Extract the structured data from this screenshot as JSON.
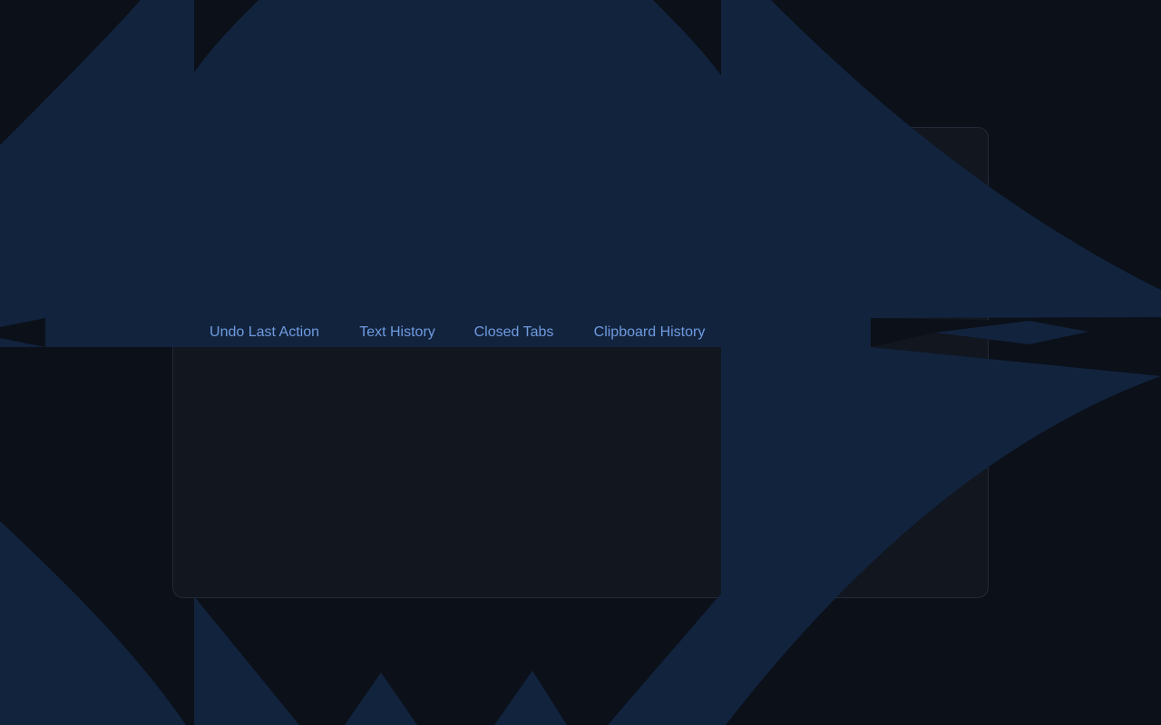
{
  "colors": {
    "background": "#0b1019",
    "overlay": "#12233d",
    "panel": "#11161f",
    "panel_border": "#232a36",
    "tab_text": "#6f9be0"
  },
  "tabs": [
    {
      "label": "Undo Last Action"
    },
    {
      "label": "Text History"
    },
    {
      "label": "Closed Tabs"
    },
    {
      "label": "Clipboard History"
    }
  ]
}
